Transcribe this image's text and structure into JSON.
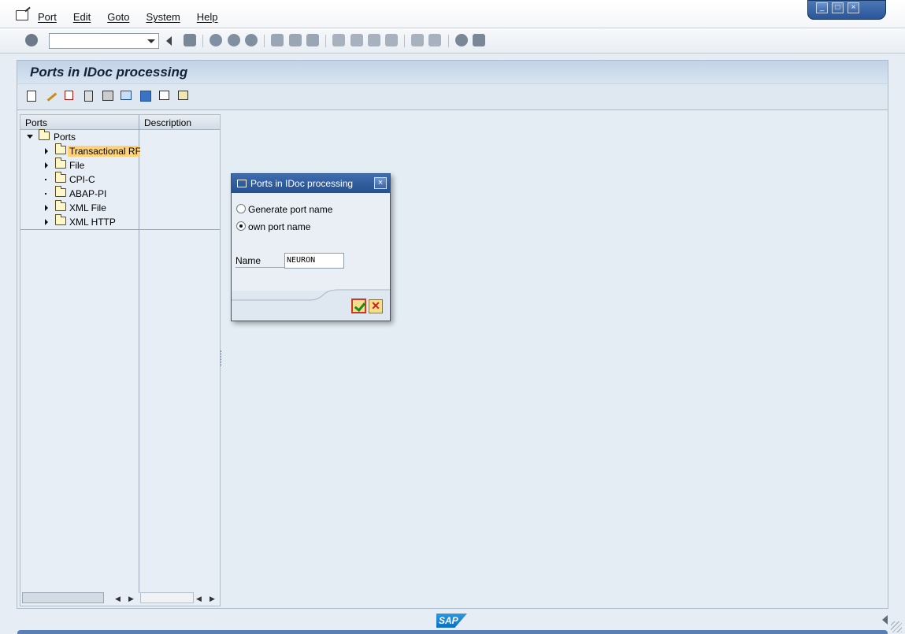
{
  "menu": {
    "items": [
      "Port",
      "Edit",
      "Goto",
      "System",
      "Help"
    ]
  },
  "toolbar": {
    "command_value": ""
  },
  "screen": {
    "title": "Ports in IDoc processing"
  },
  "tree": {
    "col_ports": "Ports",
    "col_description": "Description",
    "root": "Ports",
    "items": [
      {
        "label": "Transactional RF",
        "expandable": true,
        "selected": true
      },
      {
        "label": "File",
        "expandable": true
      },
      {
        "label": "CPI-C",
        "expandable": false
      },
      {
        "label": "ABAP-PI",
        "expandable": false
      },
      {
        "label": "XML File",
        "expandable": true
      },
      {
        "label": "XML HTTP",
        "expandable": true
      }
    ]
  },
  "dialog": {
    "title": "Ports in IDoc processing",
    "radio_generate": "Generate port name",
    "radio_own": "own port name",
    "selected_option": "own port name",
    "name_label": "Name",
    "name_value": "NEURON"
  },
  "status": {
    "logo": "SAP"
  },
  "colors": {
    "title_bar": "#c2d3e6",
    "dialog_header": "#274f8d",
    "selection": "#ffd27a"
  }
}
